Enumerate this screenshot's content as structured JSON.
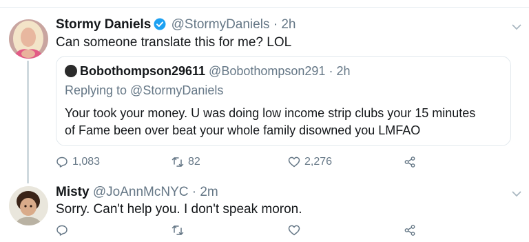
{
  "tweets": [
    {
      "display_name": "Stormy Daniels",
      "verified": true,
      "handle": "@StormyDaniels",
      "separator": "·",
      "time": "2h",
      "text": "Can someone translate this for me? LOL",
      "quoted": {
        "display_name": "Bobothompson29611",
        "handle": "@Bobothompson291",
        "separator": "·",
        "time": "2h",
        "reply_context": "Replying to @StormyDaniels",
        "text": "Your took your money. U was doing low income strip clubs your 15 minutes\nof Fame been over beat your whole family disowned you LMFAO"
      },
      "actions": {
        "replies": "1,083",
        "retweets": "82",
        "likes": "2,276"
      }
    },
    {
      "display_name": "Misty",
      "handle": "@JoAnnMcNYC",
      "separator": "·",
      "time": "2m",
      "text": "Sorry. Can't help you. I don't speak moron.",
      "actions": {
        "replies": "",
        "retweets": "",
        "likes": ""
      }
    }
  ],
  "colors": {
    "text_primary": "#14171a",
    "text_secondary": "#657786",
    "verified_blue": "#1da1f2",
    "divider": "#e6ecf0",
    "thread_line": "#cfd9de"
  },
  "icons": [
    "reply-icon",
    "retweet-icon",
    "like-icon",
    "share-icon",
    "chevron-down-icon",
    "verified-badge-icon"
  ]
}
